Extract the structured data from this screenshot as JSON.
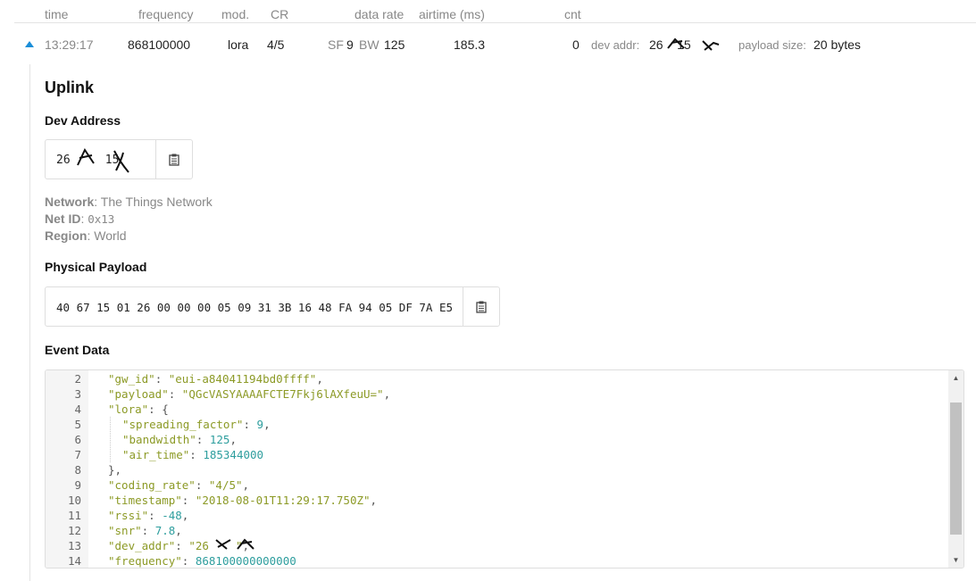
{
  "columns": {
    "time": "time",
    "frequency": "frequency",
    "mod": "mod.",
    "cr": "CR",
    "data_rate": "data rate",
    "airtime": "airtime (ms)",
    "cnt": "cnt"
  },
  "message": {
    "time": "13:29:17",
    "frequency": "868100000",
    "modulation": "lora",
    "coding_rate": "4/5",
    "sf_label": "SF",
    "sf_value": "9",
    "bw_label": "BW",
    "bw_value": "125",
    "airtime": "185.3",
    "cnt": "0",
    "dev_addr_label": "dev addr:",
    "dev_addr_value": "26    15",
    "payload_size_label": "payload size:",
    "payload_size_value": "20 bytes"
  },
  "detail": {
    "title": "Uplink",
    "dev_address_heading": "Dev Address",
    "dev_address_value": "26     15",
    "network_label": "Network",
    "network_value": ": The Things Network",
    "net_id_label": "Net ID",
    "net_id_sep": ": ",
    "net_id_value": "0x13",
    "region_label": "Region",
    "region_value": ": World",
    "physical_payload_heading": "Physical Payload",
    "physical_payload_value": "40 67 15 01 26 00 00 00 05 09 31 3B 16 48 FA 94 05 DF 7A E5",
    "event_data_heading": "Event Data"
  },
  "event_code": [
    {
      "n": "2",
      "key": "\"gw_id\"",
      "sep": ": ",
      "val": "\"eui-a84041194bd0ffff\"",
      "vt": "s",
      "tail": ",",
      "indent": 0
    },
    {
      "n": "3",
      "key": "\"payload\"",
      "sep": ": ",
      "val": "\"QGcVASYAAAAFCTE7Fkj6lAXfeuU=\"",
      "vt": "s",
      "tail": ",",
      "indent": 0
    },
    {
      "n": "4",
      "key": "\"lora\"",
      "sep": ": ",
      "val": "{",
      "vt": "p",
      "tail": "",
      "indent": 0
    },
    {
      "n": "5",
      "key": "\"spreading_factor\"",
      "sep": ": ",
      "val": "9",
      "vt": "n",
      "tail": ",",
      "indent": 1
    },
    {
      "n": "6",
      "key": "\"bandwidth\"",
      "sep": ": ",
      "val": "125",
      "vt": "n",
      "tail": ",",
      "indent": 1
    },
    {
      "n": "7",
      "key": "\"air_time\"",
      "sep": ": ",
      "val": "185344000",
      "vt": "n",
      "tail": "",
      "indent": 1
    },
    {
      "n": "8",
      "key": "",
      "sep": "",
      "val": "},",
      "vt": "p",
      "tail": "",
      "indent": 0
    },
    {
      "n": "9",
      "key": "\"coding_rate\"",
      "sep": ": ",
      "val": "\"4/5\"",
      "vt": "s",
      "tail": ",",
      "indent": 0
    },
    {
      "n": "10",
      "key": "\"timestamp\"",
      "sep": ": ",
      "val": "\"2018-08-01T11:29:17.750Z\"",
      "vt": "s",
      "tail": ",",
      "indent": 0
    },
    {
      "n": "11",
      "key": "\"rssi\"",
      "sep": ": ",
      "val": "-48",
      "vt": "n",
      "tail": ",",
      "indent": 0
    },
    {
      "n": "12",
      "key": "\"snr\"",
      "sep": ": ",
      "val": "7.8",
      "vt": "n",
      "tail": ",",
      "indent": 0
    },
    {
      "n": "13",
      "key": "\"dev_addr\"",
      "sep": ": ",
      "val": "\"26    \"",
      "vt": "s",
      "tail": ",",
      "indent": 0
    },
    {
      "n": "14",
      "key": "\"frequency\"",
      "sep": ": ",
      "val": "868100000000000",
      "vt": "n",
      "tail": "",
      "indent": 0
    }
  ],
  "icons": {
    "expand": "caret-up-icon",
    "copy": "clipboard-icon",
    "scroll_up": "triangle-up-icon",
    "scroll_down": "triangle-down-icon"
  },
  "colors": {
    "accent": "#1b8ed8",
    "json_string": "#8c9a26",
    "json_number": "#2e9e9e"
  }
}
